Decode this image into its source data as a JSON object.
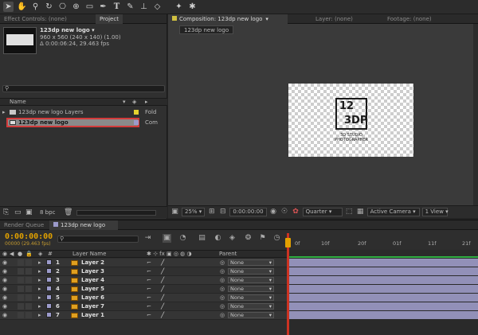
{
  "left_tabs": [
    "Effect Controls: (none)",
    "Project"
  ],
  "project": {
    "name": "123dp new logo ▾",
    "dims": "960 x 560  (240 x 140) (1.00)",
    "duration": "Δ 0:00:06:24, 29.463 fps",
    "search_placeholder": "",
    "col_name": "Name",
    "items": [
      {
        "name": "123dp new logo Layers",
        "type": "Fold"
      },
      {
        "name": "123dp new logo",
        "type": "Com"
      }
    ],
    "bpc": "8 bpc"
  },
  "viewer": {
    "tabs": [
      "Composition: 123dp new logo",
      "Layer: (none)",
      "Footage: (none)"
    ],
    "sub_tab": "123dp new logo",
    "logo_a": "12",
    "logo_b": "3DP",
    "logo_sub1": "3D STUDIO",
    "logo_sub2": "PHOTOGRAPHER",
    "zoom": "25%",
    "time": "0:00:00:00",
    "quality": "Quarter",
    "camera": "Active Camera",
    "views": "1 View"
  },
  "timeline": {
    "tabs": [
      "Render Queue",
      "123dp new logo"
    ],
    "timecode": "0:00:00:00",
    "frame_info": "00000 (29.463 fps)",
    "col_layer": "Layer Name",
    "col_parent": "Parent",
    "ruler": [
      "0f",
      "10f",
      "20f",
      "01f",
      "11f",
      "21f"
    ],
    "parent_value": "None",
    "layers": [
      {
        "num": "1",
        "name": "Layer 2"
      },
      {
        "num": "2",
        "name": "Layer 3"
      },
      {
        "num": "3",
        "name": "Layer 4"
      },
      {
        "num": "4",
        "name": "Layer 5"
      },
      {
        "num": "5",
        "name": "Layer 6"
      },
      {
        "num": "6",
        "name": "Layer 7"
      },
      {
        "num": "7",
        "name": "Layer 1"
      }
    ]
  },
  "colors": {
    "timecode": "#e1a100",
    "layer_bar": "#9290b8",
    "selection": "#d23b3b",
    "playhead": "#e4a100"
  }
}
